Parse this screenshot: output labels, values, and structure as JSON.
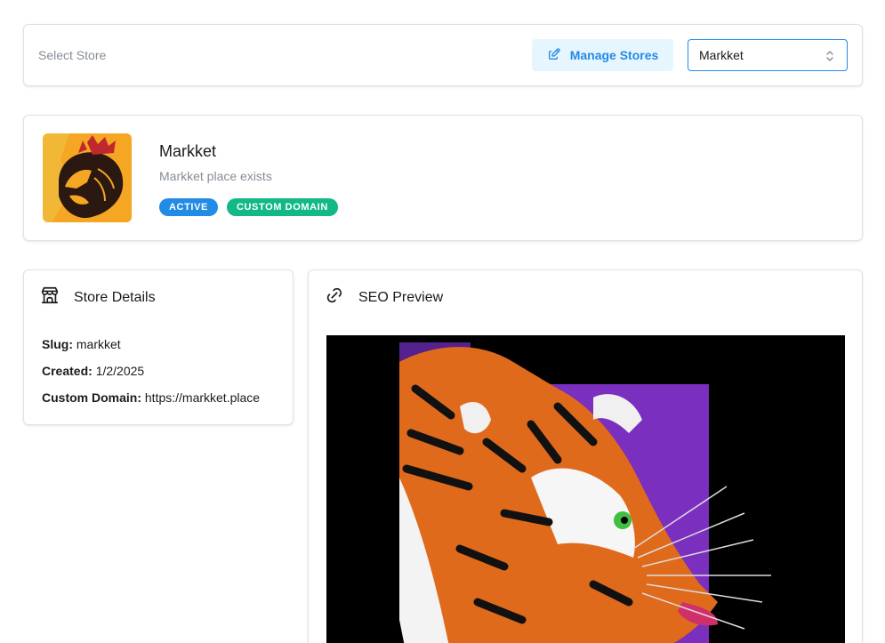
{
  "store_selector": {
    "label": "Select Store",
    "manage_button": "Manage Stores",
    "selected_store": "Markket"
  },
  "store": {
    "name": "Markket",
    "description": "Markket place exists",
    "badges": [
      {
        "label": "ACTIVE",
        "color": "#228be6"
      },
      {
        "label": "CUSTOM DOMAIN",
        "color": "#12b886"
      }
    ]
  },
  "details": {
    "title": "Store Details",
    "slug_label": "Slug:",
    "slug_value": "markket",
    "created_label": "Created:",
    "created_value": "1/2/2025",
    "domain_label": "Custom Domain:",
    "domain_value": "https://markket.place"
  },
  "seo": {
    "title": "SEO Preview"
  },
  "colors": {
    "accent": "#228be6",
    "accent_light": "#e7f5ff",
    "success": "#12b886"
  }
}
